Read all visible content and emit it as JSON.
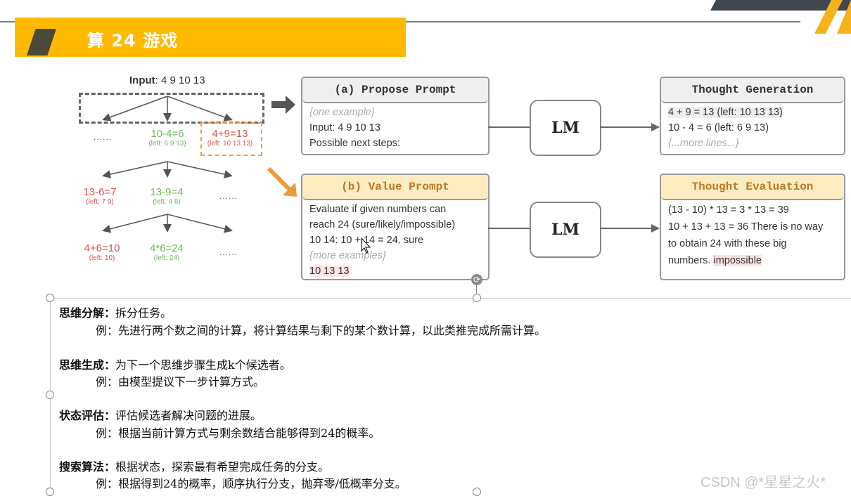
{
  "slide": {
    "title": "算 24 游戏",
    "accent_color": "#ffba00",
    "dark_color": "#4a4838"
  },
  "tree": {
    "input_label": "Input",
    "input_value": "4 9 10 13",
    "level1": [
      {
        "eq": "......",
        "left": "",
        "status": "neutral"
      },
      {
        "eq": "10-4=6",
        "left": "(left: 6 9 13)",
        "status": "good"
      },
      {
        "eq": "4+9=13",
        "left": "(left: 10 13 13)",
        "status": "bad",
        "selected": true
      }
    ],
    "level2": [
      {
        "eq": "13-6=7",
        "left": "(left: 7 9)",
        "status": "bad"
      },
      {
        "eq": "13-9=4",
        "left": "(left: 4 6)",
        "status": "good"
      },
      {
        "eq": "......",
        "left": "",
        "status": "neutral"
      }
    ],
    "level3": [
      {
        "eq": "4+6=10",
        "left": "(left: 10)",
        "status": "bad"
      },
      {
        "eq": "4*6=24",
        "left": "(left: 24)",
        "status": "good"
      },
      {
        "eq": "......",
        "left": "",
        "status": "neutral"
      }
    ]
  },
  "propose_prompt": {
    "header": "(a) Propose Prompt",
    "lines": [
      "{one example}",
      "Input: 4 9 10 13",
      "Possible next steps:"
    ]
  },
  "value_prompt": {
    "header": "(b) Value Prompt",
    "lines": [
      "Evaluate if given numbers can",
      "reach 24 (sure/likely/impossible)",
      "10 14: 10 + 14 = 24. sure",
      "{more examples}",
      "10 13 13"
    ]
  },
  "lm_label": "LM",
  "thought_generation": {
    "header": "Thought Generation",
    "lines": [
      "4 + 9 = 13 (left: 10 13 13)",
      "10 - 4 = 6 (left: 6 9 13)",
      "{...more lines...}"
    ]
  },
  "thought_evaluation": {
    "header": "Thought Evaluation",
    "lines": [
      "(13 - 10) * 13 = 3 * 13 = 39",
      "10 + 13 + 13 = 36 There is no way",
      "to obtain 24 with these big",
      "numbers.",
      "impossible"
    ]
  },
  "notes": [
    {
      "term": "思维分解：",
      "desc": "拆分任务。",
      "example": "例：先进行两个数之间的计算，将计算结果与剩下的某个数计算，以此类推完成所需计算。"
    },
    {
      "term": "思维生成：",
      "desc": "为下一个思维步骤生成k个候选者。",
      "example": "例：由模型提议下一步计算方式。"
    },
    {
      "term": "状态评估：",
      "desc": "评估候选者解决问题的进展。",
      "example": "例：根据当前计算方式与剩余数结合能够得到24的概率。"
    },
    {
      "term": "搜索算法：",
      "desc": "根据状态，探索最有希望完成任务的分支。",
      "example": "例：根据得到24的概率，顺序执行分支，抛弃零/低概率分支。"
    }
  ],
  "watermark": "CSDN @*星星之火*"
}
